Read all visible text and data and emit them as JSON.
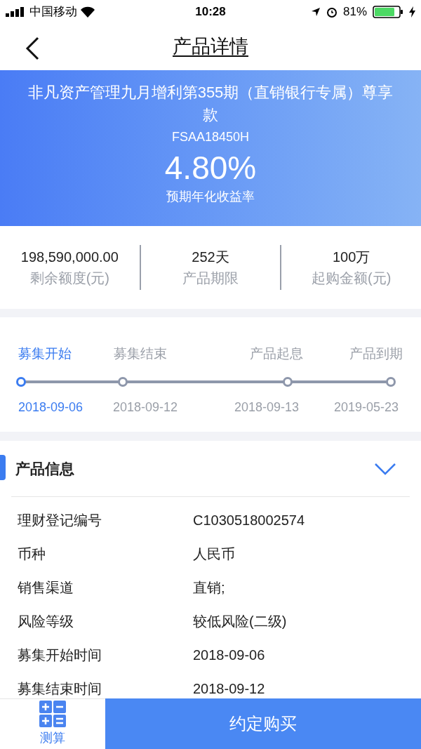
{
  "status_bar": {
    "carrier": "中国移动",
    "time": "10:28",
    "battery": "81%"
  },
  "nav": {
    "title": "产品详情"
  },
  "header": {
    "title": "非凡资产管理九月增利第355期（直销银行专属）尊享款",
    "code": "FSAA18450H",
    "rate": "4.80%",
    "rate_label": "预期年化收益率"
  },
  "stats": [
    {
      "value": "198,590,000.00",
      "label": "剩余额度(元)"
    },
    {
      "value": "252天",
      "label": "产品期限"
    },
    {
      "value": "100万",
      "label": "起购金额(元)"
    }
  ],
  "timeline": [
    {
      "label": "募集开始",
      "date": "2018-09-06",
      "selected": true
    },
    {
      "label": "募集结束",
      "date": "2018-09-12",
      "selected": false
    },
    {
      "label": "产品起息",
      "date": "2018-09-13",
      "selected": false
    },
    {
      "label": "产品到期",
      "date": "2019-05-23",
      "selected": false
    }
  ],
  "info": {
    "title": "产品信息",
    "expanded": true,
    "rows": [
      {
        "label": "理财登记编号",
        "value": "C1030518002574"
      },
      {
        "label": "币种",
        "value": "人民币"
      },
      {
        "label": "销售渠道",
        "value": "直销;"
      },
      {
        "label": "风险等级",
        "value": "较低风险(二级)"
      },
      {
        "label": "募集开始时间",
        "value": "2018-09-06"
      },
      {
        "label": "募集结束时间",
        "value": "2018-09-12"
      }
    ]
  },
  "bottom_bar": {
    "calc_label": "测算",
    "buy_button": "约定购买"
  }
}
